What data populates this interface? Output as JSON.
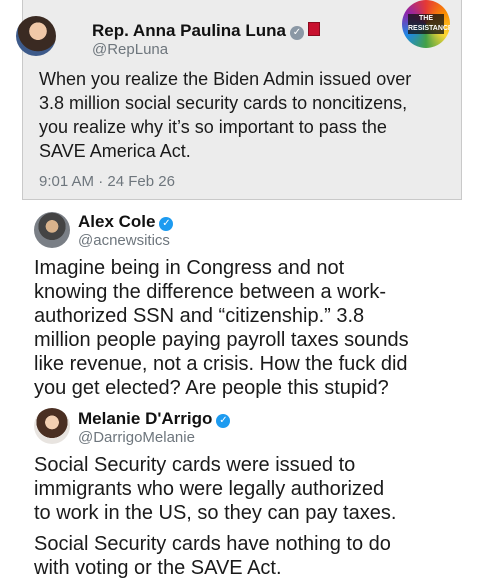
{
  "tweets": [
    {
      "author": "Rep. Anna Paulina Luna",
      "handle": "@RepLuna",
      "text": "When you realize the Biden Admin issued over\n3.8 million social security cards to noncitizens,\nyou realize why it’s so important to pass the\nSAVE America Act.",
      "timestamp": "9:01 AM · 24 Feb 26",
      "badge": "gray-check-icon",
      "extra_icon": "congress-flag-icon"
    },
    {
      "author": "Alex Cole",
      "handle": "@acnewsitics",
      "text": "Imagine being in Congress and not\nknowing the difference between a work-\nauthorized SSN and “citizenship.” 3.8\nmillion people paying payroll taxes sounds\nlike revenue, not a crisis. How the fuck did\nyou get elected? Are people this stupid?",
      "badge": "blue-check-icon"
    },
    {
      "author": "Melanie D'Arrigo",
      "handle": "@DarrigoMelanie",
      "text": "Social Security cards were issued to\nimmigrants who were legally authorized\nto work in the US, so they can pay taxes.",
      "text2": "Social Security cards have nothing to do\nwith voting or the SAVE Act.",
      "badge": "blue-check-icon"
    }
  ],
  "logo": {
    "line1": "THE",
    "line2": "RESISTANCE"
  },
  "colors": {
    "verified_blue": "#1d9bf0",
    "quoted_bg": "#ececec",
    "handle_gray": "#6e767d"
  }
}
